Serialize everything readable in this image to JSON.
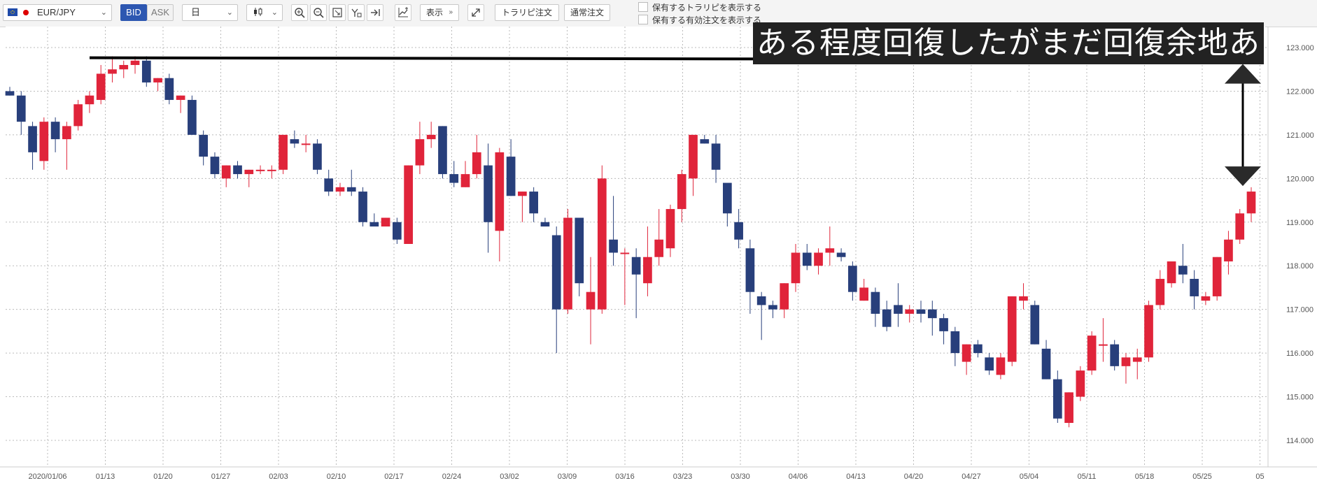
{
  "toolbar": {
    "symbol": "EUR/JPY",
    "bid_label": "BID",
    "ask_label": "ASK",
    "period": "日",
    "display_label": "表示",
    "trail_order_label": "トラリピ注文",
    "normal_order_label": "通常注文",
    "checkbox1_label": "保有するトラリピを表示する",
    "checkbox2_label": "保有する有効注文を表示する"
  },
  "annotation": {
    "text": "ある程度回復したがまだ回復余地あり"
  },
  "chart_data": {
    "type": "candlestick",
    "y_ticks": [
      "123.000",
      "122.000",
      "121.000",
      "120.000",
      "119.000",
      "118.000",
      "117.000",
      "116.000",
      "115.000",
      "114.000"
    ],
    "ylim": [
      113.6,
      123.3
    ],
    "x_labels": [
      "2020/01/06",
      "01/13",
      "01/20",
      "01/27",
      "02/03",
      "02/10",
      "02/17",
      "02/24",
      "03/02",
      "03/09",
      "03/16",
      "03/23",
      "03/30",
      "04/06",
      "04/13",
      "04/20",
      "04/27",
      "05/04",
      "05/11",
      "05/18",
      "05/25",
      "05"
    ],
    "resistance_level": 122.75,
    "colors": {
      "up": "#e0243a",
      "down": "#283f7b"
    },
    "candles": [
      {
        "o": 122.0,
        "h": 122.1,
        "l": 121.9,
        "c": 121.9
      },
      {
        "o": 121.9,
        "h": 122.0,
        "l": 121.0,
        "c": 121.3
      },
      {
        "o": 121.2,
        "h": 121.3,
        "l": 120.2,
        "c": 120.6
      },
      {
        "o": 120.4,
        "h": 121.4,
        "l": 120.2,
        "c": 121.3
      },
      {
        "o": 121.3,
        "h": 121.4,
        "l": 120.6,
        "c": 120.9
      },
      {
        "o": 120.9,
        "h": 121.3,
        "l": 120.2,
        "c": 121.2
      },
      {
        "o": 121.2,
        "h": 121.8,
        "l": 121.1,
        "c": 121.7
      },
      {
        "o": 121.7,
        "h": 122.0,
        "l": 121.5,
        "c": 121.9
      },
      {
        "o": 121.8,
        "h": 122.6,
        "l": 121.7,
        "c": 122.4
      },
      {
        "o": 122.4,
        "h": 122.8,
        "l": 122.2,
        "c": 122.5
      },
      {
        "o": 122.5,
        "h": 122.7,
        "l": 122.3,
        "c": 122.6
      },
      {
        "o": 122.6,
        "h": 122.8,
        "l": 122.4,
        "c": 122.7
      },
      {
        "o": 122.7,
        "h": 122.8,
        "l": 122.1,
        "c": 122.2
      },
      {
        "o": 122.2,
        "h": 122.3,
        "l": 122.0,
        "c": 122.3
      },
      {
        "o": 122.3,
        "h": 122.4,
        "l": 121.7,
        "c": 121.8
      },
      {
        "o": 121.8,
        "h": 121.9,
        "l": 121.5,
        "c": 121.9
      },
      {
        "o": 121.8,
        "h": 121.9,
        "l": 121.0,
        "c": 121.0
      },
      {
        "o": 121.0,
        "h": 121.1,
        "l": 120.3,
        "c": 120.5
      },
      {
        "o": 120.5,
        "h": 120.6,
        "l": 120.0,
        "c": 120.1
      },
      {
        "o": 120.0,
        "h": 120.3,
        "l": 119.8,
        "c": 120.3
      },
      {
        "o": 120.3,
        "h": 120.4,
        "l": 120.0,
        "c": 120.1
      },
      {
        "o": 120.1,
        "h": 120.2,
        "l": 119.8,
        "c": 120.2
      },
      {
        "o": 120.2,
        "h": 120.3,
        "l": 120.1,
        "c": 120.2
      },
      {
        "o": 120.2,
        "h": 120.3,
        "l": 120.0,
        "c": 120.2
      },
      {
        "o": 120.2,
        "h": 121.0,
        "l": 120.1,
        "c": 121.0
      },
      {
        "o": 120.9,
        "h": 121.1,
        "l": 120.7,
        "c": 120.8
      },
      {
        "o": 120.8,
        "h": 121.0,
        "l": 120.6,
        "c": 120.8
      },
      {
        "o": 120.8,
        "h": 120.9,
        "l": 120.1,
        "c": 120.2
      },
      {
        "o": 120.0,
        "h": 120.2,
        "l": 119.6,
        "c": 119.7
      },
      {
        "o": 119.7,
        "h": 119.9,
        "l": 119.6,
        "c": 119.8
      },
      {
        "o": 119.8,
        "h": 120.2,
        "l": 119.6,
        "c": 119.7
      },
      {
        "o": 119.7,
        "h": 119.8,
        "l": 118.9,
        "c": 119.0
      },
      {
        "o": 119.0,
        "h": 119.2,
        "l": 118.9,
        "c": 118.9
      },
      {
        "o": 118.9,
        "h": 119.1,
        "l": 118.9,
        "c": 119.1
      },
      {
        "o": 119.0,
        "h": 119.1,
        "l": 118.5,
        "c": 118.6
      },
      {
        "o": 118.5,
        "h": 120.3,
        "l": 118.5,
        "c": 120.3
      },
      {
        "o": 120.3,
        "h": 121.3,
        "l": 120.1,
        "c": 120.9
      },
      {
        "o": 120.9,
        "h": 121.3,
        "l": 120.7,
        "c": 121.0
      },
      {
        "o": 121.2,
        "h": 121.2,
        "l": 120.0,
        "c": 120.1
      },
      {
        "o": 120.1,
        "h": 120.4,
        "l": 119.8,
        "c": 119.9
      },
      {
        "o": 119.8,
        "h": 120.4,
        "l": 119.8,
        "c": 120.1
      },
      {
        "o": 120.1,
        "h": 121.0,
        "l": 120.0,
        "c": 120.6
      },
      {
        "o": 120.3,
        "h": 120.8,
        "l": 118.3,
        "c": 119.0
      },
      {
        "o": 118.8,
        "h": 120.7,
        "l": 118.1,
        "c": 120.6
      },
      {
        "o": 120.5,
        "h": 120.9,
        "l": 119.6,
        "c": 119.6
      },
      {
        "o": 119.6,
        "h": 119.7,
        "l": 119.0,
        "c": 119.7
      },
      {
        "o": 119.7,
        "h": 119.8,
        "l": 119.0,
        "c": 119.2
      },
      {
        "o": 119.0,
        "h": 119.1,
        "l": 118.9,
        "c": 118.9
      },
      {
        "o": 118.7,
        "h": 118.9,
        "l": 116.0,
        "c": 117.0
      },
      {
        "o": 117.0,
        "h": 119.3,
        "l": 116.9,
        "c": 119.1
      },
      {
        "o": 119.1,
        "h": 119.0,
        "l": 117.3,
        "c": 117.6
      },
      {
        "o": 117.0,
        "h": 118.2,
        "l": 116.2,
        "c": 117.4
      },
      {
        "o": 117.0,
        "h": 120.3,
        "l": 116.9,
        "c": 120.0
      },
      {
        "o": 118.6,
        "h": 119.6,
        "l": 118.0,
        "c": 118.3
      },
      {
        "o": 118.3,
        "h": 118.4,
        "l": 117.1,
        "c": 118.3
      },
      {
        "o": 118.2,
        "h": 118.4,
        "l": 116.8,
        "c": 117.8
      },
      {
        "o": 117.6,
        "h": 118.9,
        "l": 117.3,
        "c": 118.2
      },
      {
        "o": 118.2,
        "h": 119.3,
        "l": 118.0,
        "c": 118.6
      },
      {
        "o": 118.4,
        "h": 119.4,
        "l": 118.2,
        "c": 119.3
      },
      {
        "o": 119.3,
        "h": 120.2,
        "l": 119.0,
        "c": 120.1
      },
      {
        "o": 120.0,
        "h": 121.0,
        "l": 119.6,
        "c": 121.0
      },
      {
        "o": 120.9,
        "h": 121.0,
        "l": 120.8,
        "c": 120.8
      },
      {
        "o": 120.8,
        "h": 121.0,
        "l": 119.9,
        "c": 120.2
      },
      {
        "o": 119.9,
        "h": 119.8,
        "l": 118.9,
        "c": 119.2
      },
      {
        "o": 119.0,
        "h": 119.3,
        "l": 118.4,
        "c": 118.6
      },
      {
        "o": 118.4,
        "h": 118.6,
        "l": 116.9,
        "c": 117.4
      },
      {
        "o": 117.3,
        "h": 117.4,
        "l": 116.3,
        "c": 117.1
      },
      {
        "o": 117.1,
        "h": 117.2,
        "l": 116.8,
        "c": 117.0
      },
      {
        "o": 117.0,
        "h": 117.6,
        "l": 116.8,
        "c": 117.6
      },
      {
        "o": 117.6,
        "h": 118.5,
        "l": 117.4,
        "c": 118.3
      },
      {
        "o": 118.3,
        "h": 118.5,
        "l": 117.9,
        "c": 118.0
      },
      {
        "o": 118.0,
        "h": 118.4,
        "l": 117.8,
        "c": 118.3
      },
      {
        "o": 118.3,
        "h": 118.9,
        "l": 118.0,
        "c": 118.4
      },
      {
        "o": 118.3,
        "h": 118.4,
        "l": 118.1,
        "c": 118.2
      },
      {
        "o": 118.0,
        "h": 118.1,
        "l": 117.2,
        "c": 117.4
      },
      {
        "o": 117.2,
        "h": 117.7,
        "l": 117.2,
        "c": 117.5
      },
      {
        "o": 117.4,
        "h": 117.5,
        "l": 116.6,
        "c": 116.9
      },
      {
        "o": 117.0,
        "h": 117.2,
        "l": 116.5,
        "c": 116.6
      },
      {
        "o": 117.1,
        "h": 117.6,
        "l": 116.6,
        "c": 116.9
      },
      {
        "o": 116.9,
        "h": 117.1,
        "l": 116.7,
        "c": 117.0
      },
      {
        "o": 117.0,
        "h": 117.2,
        "l": 116.7,
        "c": 116.9
      },
      {
        "o": 117.0,
        "h": 117.2,
        "l": 116.4,
        "c": 116.8
      },
      {
        "o": 116.8,
        "h": 116.9,
        "l": 116.2,
        "c": 116.5
      },
      {
        "o": 116.5,
        "h": 116.6,
        "l": 115.7,
        "c": 116.0
      },
      {
        "o": 115.8,
        "h": 116.2,
        "l": 115.5,
        "c": 116.2
      },
      {
        "o": 116.2,
        "h": 116.3,
        "l": 115.9,
        "c": 116.0
      },
      {
        "o": 115.9,
        "h": 116.0,
        "l": 115.5,
        "c": 115.6
      },
      {
        "o": 115.5,
        "h": 116.0,
        "l": 115.4,
        "c": 115.9
      },
      {
        "o": 115.8,
        "h": 117.3,
        "l": 115.7,
        "c": 117.3
      },
      {
        "o": 117.2,
        "h": 117.6,
        "l": 117.0,
        "c": 117.3
      },
      {
        "o": 117.1,
        "h": 117.2,
        "l": 116.2,
        "c": 116.2
      },
      {
        "o": 116.1,
        "h": 116.3,
        "l": 115.4,
        "c": 115.4
      },
      {
        "o": 115.4,
        "h": 115.6,
        "l": 114.4,
        "c": 114.5
      },
      {
        "o": 114.4,
        "h": 115.1,
        "l": 114.3,
        "c": 115.1
      },
      {
        "o": 115.0,
        "h": 115.7,
        "l": 114.9,
        "c": 115.6
      },
      {
        "o": 115.6,
        "h": 116.5,
        "l": 115.5,
        "c": 116.4
      },
      {
        "o": 116.2,
        "h": 116.8,
        "l": 115.8,
        "c": 116.2
      },
      {
        "o": 116.2,
        "h": 116.3,
        "l": 115.6,
        "c": 115.7
      },
      {
        "o": 115.7,
        "h": 116.0,
        "l": 115.3,
        "c": 115.9
      },
      {
        "o": 115.8,
        "h": 116.1,
        "l": 115.4,
        "c": 115.9
      },
      {
        "o": 115.9,
        "h": 117.2,
        "l": 115.8,
        "c": 117.1
      },
      {
        "o": 117.1,
        "h": 117.9,
        "l": 117.0,
        "c": 117.7
      },
      {
        "o": 117.6,
        "h": 118.1,
        "l": 117.5,
        "c": 118.1
      },
      {
        "o": 118.0,
        "h": 118.5,
        "l": 117.6,
        "c": 117.8
      },
      {
        "o": 117.7,
        "h": 117.9,
        "l": 117.0,
        "c": 117.3
      },
      {
        "o": 117.2,
        "h": 117.4,
        "l": 117.1,
        "c": 117.3
      },
      {
        "o": 117.3,
        "h": 118.2,
        "l": 117.2,
        "c": 118.2
      },
      {
        "o": 118.1,
        "h": 118.8,
        "l": 117.8,
        "c": 118.6
      },
      {
        "o": 118.6,
        "h": 119.3,
        "l": 118.5,
        "c": 119.2
      },
      {
        "o": 119.2,
        "h": 119.8,
        "l": 119.0,
        "c": 119.7
      }
    ]
  }
}
